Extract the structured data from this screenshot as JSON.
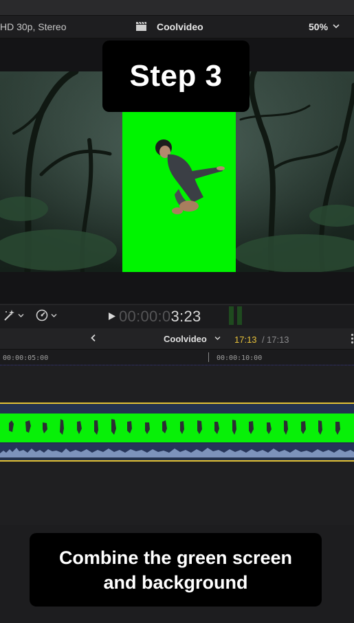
{
  "viewer": {
    "format": "HD 30p, Stereo",
    "title": "Coolvideo",
    "zoom": "50%"
  },
  "overlay": {
    "step_title": "Step 3"
  },
  "transport": {
    "timecode_dim": "00:00:0",
    "timecode_bright": "3:23"
  },
  "timeline": {
    "name": "Coolvideo",
    "current_time": "17:13",
    "separator": "/",
    "total_time": "17:13",
    "ruler_marks": [
      "00:00:05:00",
      "00:00:10:00"
    ]
  },
  "caption": {
    "line1": "Combine the green screen",
    "line2": "and background"
  },
  "colors": {
    "green_screen": "#00f400",
    "clip_border": "#e3c236",
    "current_time": "#e8c23a",
    "clip_audio": "#26355a"
  }
}
